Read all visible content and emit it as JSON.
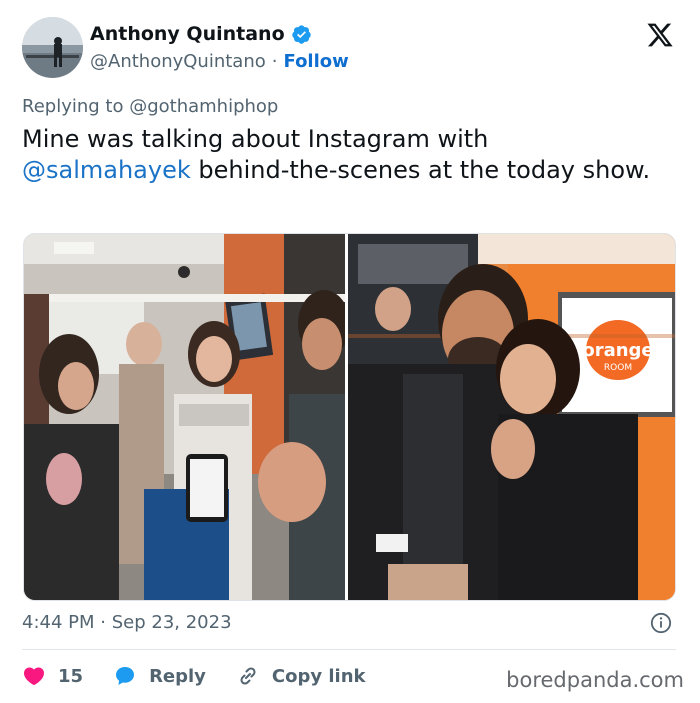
{
  "author": {
    "display_name": "Anthony Quintano",
    "handle": "@AnthonyQuintano",
    "separator": "·",
    "follow_label": "Follow",
    "verified": true
  },
  "reply": {
    "prefix": "Replying to ",
    "to": "@gothamhiphop"
  },
  "tweet": {
    "text_part1": "Mine was talking about Instagram with ",
    "mention": "@salmahayek",
    "text_part2": " behind-the-scenes at the today show."
  },
  "media": {
    "right_sign_text": "orange",
    "right_sign_subtext": "ROOM"
  },
  "meta": {
    "time": "4:44 PM",
    "separator": "·",
    "date": "Sep 23, 2023"
  },
  "actions": {
    "like_count": "15",
    "reply_label": "Reply",
    "copy_label": "Copy link"
  },
  "watermark": "boredpanda.com",
  "colors": {
    "accent": "#1a73c7",
    "like": "#f91880",
    "reply": "#1d9bf0",
    "muted": "#536471"
  }
}
